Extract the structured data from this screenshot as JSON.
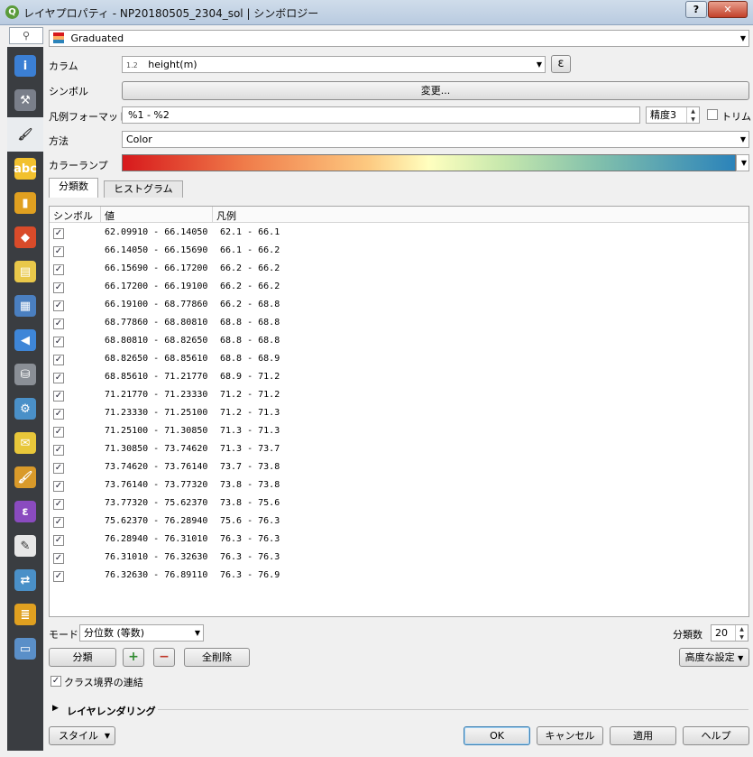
{
  "window": {
    "title": "レイヤプロパティ - NP20180505_2304_sol | シンボロジー",
    "help_label": "?",
    "close_label": "✕",
    "app_icon_label": "Q"
  },
  "sidebar": {
    "search_icon": "⚲",
    "items": [
      {
        "icon": "information-icon",
        "glyph": "i",
        "color": "#3b7fd4"
      },
      {
        "icon": "source-icon",
        "glyph": "⚒",
        "color": "#7a7f8a"
      },
      {
        "icon": "symbology-icon",
        "glyph": "🖌",
        "color": "#e9ecef"
      },
      {
        "icon": "labels-icon",
        "glyph": "abc",
        "color": "#f2c12e"
      },
      {
        "icon": "diagrams-icon",
        "glyph": "▮",
        "color": "#e0a020"
      },
      {
        "icon": "3d-view-icon",
        "glyph": "◆",
        "color": "#d94b2a"
      },
      {
        "icon": "fields-icon",
        "glyph": "▤",
        "color": "#e9c84a"
      },
      {
        "icon": "attributes-form-icon",
        "glyph": "▦",
        "color": "#4a7fc0"
      },
      {
        "icon": "joins-icon",
        "glyph": "◀",
        "color": "#3e86d8"
      },
      {
        "icon": "auxiliary-storage-icon",
        "glyph": "⛁",
        "color": "#8a8f96"
      },
      {
        "icon": "actions-icon",
        "glyph": "⚙",
        "color": "#4a90c8"
      },
      {
        "icon": "display-icon",
        "glyph": "✉",
        "color": "#e8c73a"
      },
      {
        "icon": "rendering-icon",
        "glyph": "🖌",
        "color": "#d99a2a"
      },
      {
        "icon": "variables-icon",
        "glyph": "ε",
        "color": "#8a4bbf"
      },
      {
        "icon": "metadata-icon",
        "glyph": "✎",
        "color": "#e7e7e7"
      },
      {
        "icon": "dependencies-icon",
        "glyph": "⇄",
        "color": "#4a90c8"
      },
      {
        "icon": "legend-icon",
        "glyph": "≣",
        "color": "#e0a020"
      },
      {
        "icon": "qgis-server-icon",
        "glyph": "▭",
        "color": "#5a8fc8"
      }
    ]
  },
  "renderer": {
    "value": "Graduated"
  },
  "column": {
    "label": "カラム",
    "type_badge": "1.2",
    "value": "height(m)",
    "expr_label": "ε"
  },
  "symbol": {
    "label": "シンボル",
    "change_label": "変更..."
  },
  "legend_format": {
    "label": "凡例フォーマット",
    "value": "%1 - %2",
    "precision_label": "精度3",
    "trim_label": "トリム"
  },
  "method": {
    "label": "方法",
    "value": "Color"
  },
  "color_ramp": {
    "label": "カラーランプ"
  },
  "tabs": [
    {
      "label": "分類数"
    },
    {
      "label": "ヒストグラム"
    }
  ],
  "table": {
    "headers": {
      "symbol": "シンボル",
      "value": "値",
      "legend": "凡例"
    },
    "rows": [
      {
        "value": "62.09910 - 66.14050",
        "legend": "62.1 - 66.1",
        "checked": "✓"
      },
      {
        "value": "66.14050 - 66.15690",
        "legend": "66.1 - 66.2",
        "checked": "✓"
      },
      {
        "value": "66.15690 - 66.17200",
        "legend": "66.2 - 66.2",
        "checked": "✓"
      },
      {
        "value": "66.17200 - 66.19100",
        "legend": "66.2 - 66.2",
        "checked": "✓"
      },
      {
        "value": "66.19100 - 68.77860",
        "legend": "66.2 - 68.8",
        "checked": "✓"
      },
      {
        "value": "68.77860 - 68.80810",
        "legend": "68.8 - 68.8",
        "checked": "✓"
      },
      {
        "value": "68.80810 - 68.82650",
        "legend": "68.8 - 68.8",
        "checked": "✓"
      },
      {
        "value": "68.82650 - 68.85610",
        "legend": "68.8 - 68.9",
        "checked": "✓"
      },
      {
        "value": "68.85610 - 71.21770",
        "legend": "68.9 - 71.2",
        "checked": "✓"
      },
      {
        "value": "71.21770 - 71.23330",
        "legend": "71.2 - 71.2",
        "checked": "✓"
      },
      {
        "value": "71.23330 - 71.25100",
        "legend": "71.2 - 71.3",
        "checked": "✓"
      },
      {
        "value": "71.25100 - 71.30850",
        "legend": "71.3 - 71.3",
        "checked": "✓"
      },
      {
        "value": "71.30850 - 73.74620",
        "legend": "71.3 - 73.7",
        "checked": "✓"
      },
      {
        "value": "73.74620 - 73.76140",
        "legend": "73.7 - 73.8",
        "checked": "✓"
      },
      {
        "value": "73.76140 - 73.77320",
        "legend": "73.8 - 73.8",
        "checked": "✓"
      },
      {
        "value": "73.77320 - 75.62370",
        "legend": "73.8 - 75.6",
        "checked": "✓"
      },
      {
        "value": "75.62370 - 76.28940",
        "legend": "75.6 - 76.3",
        "checked": "✓"
      },
      {
        "value": "76.28940 - 76.31010",
        "legend": "76.3 - 76.3",
        "checked": "✓"
      },
      {
        "value": "76.31010 - 76.32630",
        "legend": "76.3 - 76.3",
        "checked": "✓"
      },
      {
        "value": "76.32630 - 76.89110",
        "legend": "76.3 - 76.9",
        "checked": "✓"
      }
    ]
  },
  "mode": {
    "label": "モード",
    "value": "分位数 (等数)"
  },
  "classes": {
    "label": "分類数",
    "value": "20"
  },
  "actions": {
    "classify_label": "分類",
    "add_label": "+",
    "remove_label": "−",
    "delete_all_label": "全削除",
    "advanced_label": "高度な設定"
  },
  "link_boundaries": {
    "label": "クラス境界の連結",
    "checked": "✓"
  },
  "layer_rendering": {
    "label": "レイヤレンダリング"
  },
  "footer": {
    "style_label": "スタイル",
    "ok_label": "OK",
    "cancel_label": "キャンセル",
    "apply_label": "適用",
    "help_label": "ヘルプ"
  },
  "colors": {
    "titlebar": "#c4d3e5",
    "sidebar": "#3a3d41",
    "ramp_start": "#d7191c",
    "ramp_end": "#2b83ba"
  }
}
